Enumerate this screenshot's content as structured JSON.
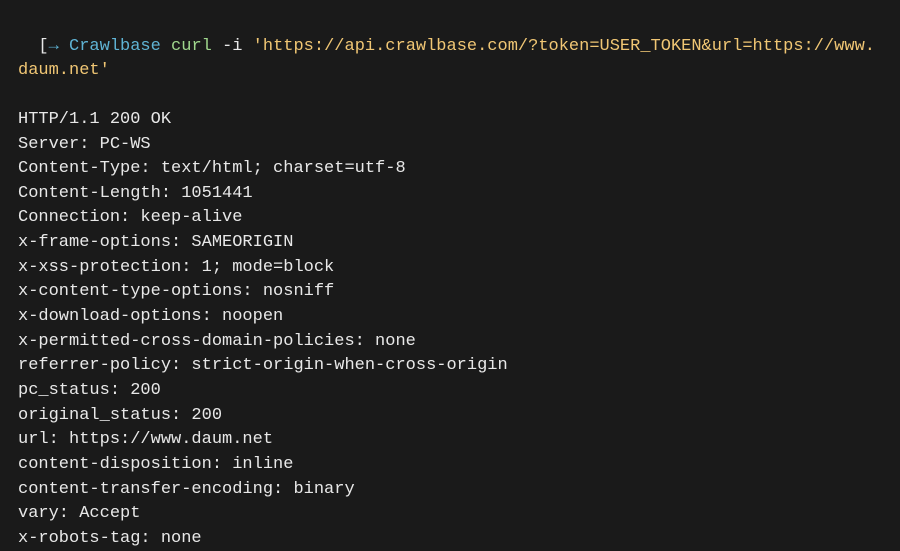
{
  "prompt": {
    "bracket": "[",
    "arrow": "→",
    "name": "Crawlbase",
    "command": "curl",
    "flag": "-i",
    "url": "'https://api.crawlbase.com/?token=USER_TOKEN&url=https://www.daum.net'"
  },
  "response": {
    "status_line": "HTTP/1.1 200 OK",
    "headers": [
      "Server: PC-WS",
      "Content-Type: text/html; charset=utf-8",
      "Content-Length: 1051441",
      "Connection: keep-alive",
      "x-frame-options: SAMEORIGIN",
      "x-xss-protection: 1; mode=block",
      "x-content-type-options: nosniff",
      "x-download-options: noopen",
      "x-permitted-cross-domain-policies: none",
      "referrer-policy: strict-origin-when-cross-origin",
      "pc_status: 200",
      "original_status: 200",
      "url: https://www.daum.net",
      "content-disposition: inline",
      "content-transfer-encoding: binary",
      "vary: Accept",
      "x-robots-tag: none"
    ]
  }
}
